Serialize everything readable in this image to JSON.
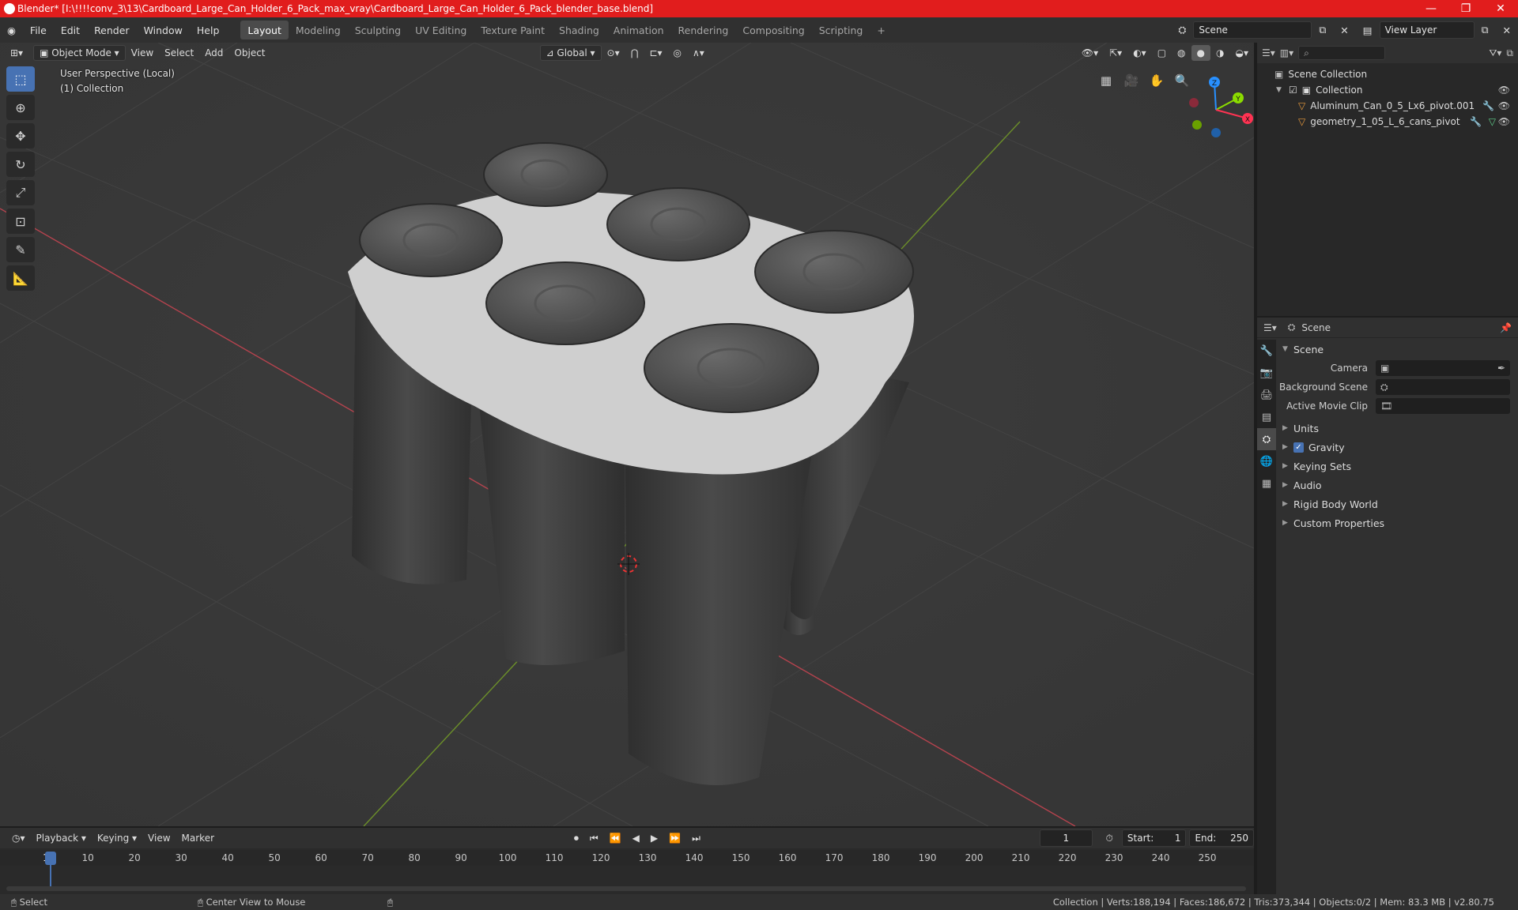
{
  "window": {
    "title": "Blender* [I:\\!!!!conv_3\\13\\Cardboard_Large_Can_Holder_6_Pack_max_vray\\Cardboard_Large_Can_Holder_6_Pack_blender_base.blend]",
    "min": "—",
    "max": "❐",
    "close": "✕"
  },
  "menu": {
    "items": [
      "File",
      "Edit",
      "Render",
      "Window",
      "Help"
    ],
    "workspaces": [
      "Layout",
      "Modeling",
      "Sculpting",
      "UV Editing",
      "Texture Paint",
      "Shading",
      "Animation",
      "Rendering",
      "Compositing",
      "Scripting"
    ],
    "add_ws": "+",
    "scene": "Scene",
    "view_layer": "View Layer"
  },
  "viewport": {
    "mode": "Object Mode",
    "view": "View",
    "select": "Select",
    "add": "Add",
    "object": "Object",
    "orientation": "Global",
    "perspective_label": "User Perspective (Local)",
    "collection_label": "(1) Collection",
    "gizmo": {
      "x": "X",
      "y": "Y",
      "z": "Z"
    }
  },
  "outliner": {
    "search_placeholder": "",
    "root": "Scene Collection",
    "collection": "Collection",
    "objects": [
      "Aluminum_Can_0_5_Lx6_pivot.001",
      "geometry_1_05_L_6_cans_pivot"
    ]
  },
  "properties": {
    "header": "Scene",
    "panel": "Scene",
    "camera_label": "Camera",
    "bg_scene_label": "Background Scene",
    "movie_clip_label": "Active Movie Clip",
    "sections": [
      "Units",
      "Gravity",
      "Keying Sets",
      "Audio",
      "Rigid Body World",
      "Custom Properties"
    ]
  },
  "timeline": {
    "playback": "Playback",
    "keying": "Keying",
    "view": "View",
    "marker": "Marker",
    "current_frame": "1",
    "start_label": "Start:",
    "start": "1",
    "end_label": "End:",
    "end": "250",
    "ticks": [
      "1",
      "10",
      "20",
      "30",
      "40",
      "50",
      "60",
      "70",
      "80",
      "90",
      "100",
      "110",
      "120",
      "130",
      "140",
      "150",
      "160",
      "170",
      "180",
      "190",
      "200",
      "210",
      "220",
      "230",
      "240",
      "250"
    ]
  },
  "status": {
    "select": "Select",
    "center_view": "Center View to Mouse",
    "stats": "Collection | Verts:188,194 | Faces:186,672 | Tris:373,344 | Objects:0/2 | Mem: 83.3 MB | v2.80.75"
  },
  "colors": {
    "accent": "#4772b3",
    "titlebar": "#e11d1d",
    "x_axis": "#ff3352",
    "y_axis": "#8bdc00",
    "z_axis": "#2890ff"
  }
}
